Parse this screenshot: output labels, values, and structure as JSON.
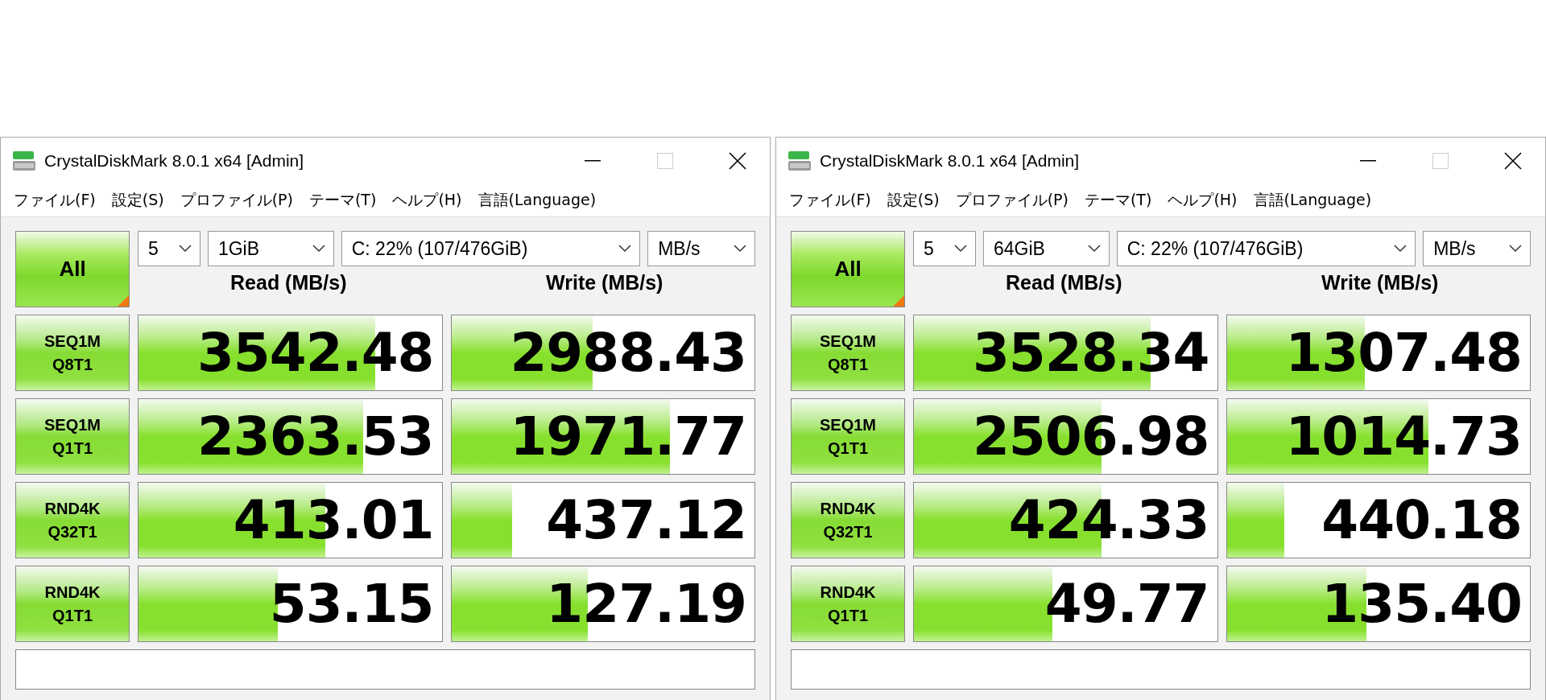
{
  "windows": [
    {
      "title": "CrystalDiskMark 8.0.1 x64 [Admin]",
      "menu": [
        "ファイル(F)",
        "設定(S)",
        "プロファイル(P)",
        "テーマ(T)",
        "ヘルプ(H)",
        "言語(Language)"
      ],
      "all_button": "All",
      "selects": [
        "5",
        "1GiB",
        "C: 22% (107/476GiB)",
        "MB/s"
      ],
      "headers": [
        "Read (MB/s)",
        "Write (MB/s)"
      ],
      "rows": [
        {
          "label": [
            "SEQ1M",
            "Q8T1"
          ],
          "read": {
            "value": "3542.48",
            "level": 0.78
          },
          "write": {
            "value": "2988.43",
            "level": 0.465
          }
        },
        {
          "label": [
            "SEQ1M",
            "Q1T1"
          ],
          "read": {
            "value": "2363.53",
            "level": 0.74
          },
          "write": {
            "value": "1971.77",
            "level": 0.72
          }
        },
        {
          "label": [
            "RND4K",
            "Q32T1"
          ],
          "read": {
            "value": "413.01",
            "level": 0.615
          },
          "write": {
            "value": "437.12",
            "level": 0.2
          }
        },
        {
          "label": [
            "RND4K",
            "Q1T1"
          ],
          "read": {
            "value": "53.15",
            "level": 0.46
          },
          "write": {
            "value": "127.19",
            "level": 0.45
          }
        }
      ]
    },
    {
      "title": "CrystalDiskMark 8.0.1 x64 [Admin]",
      "menu": [
        "ファイル(F)",
        "設定(S)",
        "プロファイル(P)",
        "テーマ(T)",
        "ヘルプ(H)",
        "言語(Language)"
      ],
      "all_button": "All",
      "selects": [
        "5",
        "64GiB",
        "C: 22% (107/476GiB)",
        "MB/s"
      ],
      "headers": [
        "Read (MB/s)",
        "Write (MB/s)"
      ],
      "rows": [
        {
          "label": [
            "SEQ1M",
            "Q8T1"
          ],
          "read": {
            "value": "3528.34",
            "level": 0.78
          },
          "write": {
            "value": "1307.48",
            "level": 0.455
          }
        },
        {
          "label": [
            "SEQ1M",
            "Q1T1"
          ],
          "read": {
            "value": "2506.98",
            "level": 0.62
          },
          "write": {
            "value": "1014.73",
            "level": 0.665
          }
        },
        {
          "label": [
            "RND4K",
            "Q32T1"
          ],
          "read": {
            "value": "424.33",
            "level": 0.62
          },
          "write": {
            "value": "440.18",
            "level": 0.19
          }
        },
        {
          "label": [
            "RND4K",
            "Q1T1"
          ],
          "read": {
            "value": "49.77",
            "level": 0.457
          },
          "write": {
            "value": "135.40",
            "level": 0.46
          }
        }
      ]
    }
  ]
}
